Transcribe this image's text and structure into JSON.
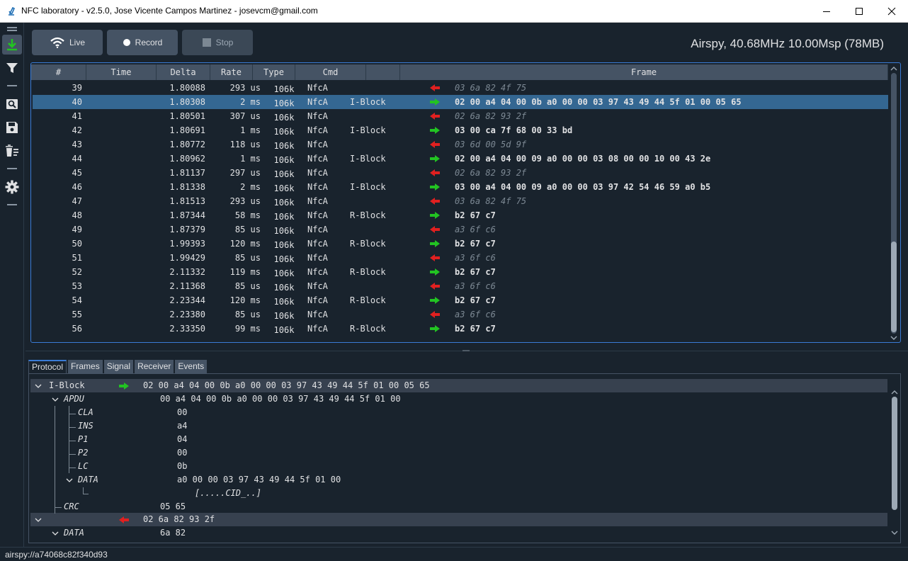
{
  "window": {
    "title": "NFC laboratory - v2.5.0, Jose Vicente Campos Martinez - josevcm@gmail.com"
  },
  "toolbar": {
    "live_label": "Live",
    "record_label": "Record",
    "stop_label": "Stop",
    "device_info": "Airspy, 40.68MHz 10.00Msp (78MB)"
  },
  "left_tools": [
    "download-icon",
    "filter-icon",
    "zoom-icon",
    "save-icon",
    "clear-icon",
    "gear-icon"
  ],
  "frames": {
    "columns": [
      "#",
      "Time",
      "Delta",
      "Rate",
      "Type",
      "Cmd",
      "",
      "Frame"
    ],
    "rows": [
      {
        "num": "39",
        "time": "1.80088",
        "delta": "293 us",
        "rate": "106k",
        "type": "NfcA",
        "cmd": "",
        "dir": "rx",
        "frame": "03 6a 82 4f 75"
      },
      {
        "num": "40",
        "time": "1.80308",
        "delta": "2 ms",
        "rate": "106k",
        "type": "NfcA",
        "cmd": "I-Block",
        "dir": "tx",
        "frame": "02 00 a4 04 00 0b a0 00 00 03 97 43 49 44 5f 01 00 05 65",
        "selected": true
      },
      {
        "num": "41",
        "time": "1.80501",
        "delta": "307 us",
        "rate": "106k",
        "type": "NfcA",
        "cmd": "",
        "dir": "rx",
        "frame": "02 6a 82 93 2f"
      },
      {
        "num": "42",
        "time": "1.80691",
        "delta": "1 ms",
        "rate": "106k",
        "type": "NfcA",
        "cmd": "I-Block",
        "dir": "tx",
        "frame": "03 00 ca 7f 68 00 33 bd"
      },
      {
        "num": "43",
        "time": "1.80772",
        "delta": "118 us",
        "rate": "106k",
        "type": "NfcA",
        "cmd": "",
        "dir": "rx",
        "frame": "03 6d 00 5d 9f"
      },
      {
        "num": "44",
        "time": "1.80962",
        "delta": "1 ms",
        "rate": "106k",
        "type": "NfcA",
        "cmd": "I-Block",
        "dir": "tx",
        "frame": "02 00 a4 04 00 09 a0 00 00 03 08 00 00 10 00 43 2e"
      },
      {
        "num": "45",
        "time": "1.81137",
        "delta": "297 us",
        "rate": "106k",
        "type": "NfcA",
        "cmd": "",
        "dir": "rx",
        "frame": "02 6a 82 93 2f"
      },
      {
        "num": "46",
        "time": "1.81338",
        "delta": "2 ms",
        "rate": "106k",
        "type": "NfcA",
        "cmd": "I-Block",
        "dir": "tx",
        "frame": "03 00 a4 04 00 09 a0 00 00 03 97 42 54 46 59 a0 b5"
      },
      {
        "num": "47",
        "time": "1.81513",
        "delta": "293 us",
        "rate": "106k",
        "type": "NfcA",
        "cmd": "",
        "dir": "rx",
        "frame": "03 6a 82 4f 75"
      },
      {
        "num": "48",
        "time": "1.87344",
        "delta": "58 ms",
        "rate": "106k",
        "type": "NfcA",
        "cmd": "R-Block",
        "dir": "tx",
        "frame": "b2 67 c7"
      },
      {
        "num": "49",
        "time": "1.87379",
        "delta": "85 us",
        "rate": "106k",
        "type": "NfcA",
        "cmd": "",
        "dir": "rx",
        "frame": "a3 6f c6"
      },
      {
        "num": "50",
        "time": "1.99393",
        "delta": "120 ms",
        "rate": "106k",
        "type": "NfcA",
        "cmd": "R-Block",
        "dir": "tx",
        "frame": "b2 67 c7"
      },
      {
        "num": "51",
        "time": "1.99429",
        "delta": "85 us",
        "rate": "106k",
        "type": "NfcA",
        "cmd": "",
        "dir": "rx",
        "frame": "a3 6f c6"
      },
      {
        "num": "52",
        "time": "2.11332",
        "delta": "119 ms",
        "rate": "106k",
        "type": "NfcA",
        "cmd": "R-Block",
        "dir": "tx",
        "frame": "b2 67 c7"
      },
      {
        "num": "53",
        "time": "2.11368",
        "delta": "85 us",
        "rate": "106k",
        "type": "NfcA",
        "cmd": "",
        "dir": "rx",
        "frame": "a3 6f c6"
      },
      {
        "num": "54",
        "time": "2.23344",
        "delta": "120 ms",
        "rate": "106k",
        "type": "NfcA",
        "cmd": "R-Block",
        "dir": "tx",
        "frame": "b2 67 c7"
      },
      {
        "num": "55",
        "time": "2.23380",
        "delta": "85 us",
        "rate": "106k",
        "type": "NfcA",
        "cmd": "",
        "dir": "rx",
        "frame": "a3 6f c6"
      },
      {
        "num": "56",
        "time": "2.33350",
        "delta": "99 ms",
        "rate": "106k",
        "type": "NfcA",
        "cmd": "R-Block",
        "dir": "tx",
        "frame": "b2 67 c7"
      }
    ]
  },
  "tabs": [
    {
      "label": "Protocol",
      "active": true
    },
    {
      "label": "Frames"
    },
    {
      "label": "Signal"
    },
    {
      "label": "Receiver"
    },
    {
      "label": "Events"
    }
  ],
  "protocol_tree": {
    "iblock_name": "I-Block",
    "iblock_value": "02 00 a4 04 00 0b a0 00 00 03 97 43 49 44 5f 01 00 05 65",
    "apdu_name": "APDU",
    "apdu_value": "00 a4 04 00 0b a0 00 00 03 97 43 49 44 5f 01 00",
    "cla_name": "CLA",
    "cla_value": "00",
    "ins_name": "INS",
    "ins_value": "a4",
    "p1_name": "P1",
    "p1_value": "04",
    "p2_name": "P2",
    "p2_value": "00",
    "lc_name": "LC",
    "lc_value": "0b",
    "data_name": "DATA",
    "data_value": "a0 00 00 03 97 43 49 44 5f 01 00",
    "data_ascii": "[.....CID_..]",
    "crc_name": "CRC",
    "crc_value": "05 65",
    "resp_value": "02 6a 82 93 2f",
    "resp_data_name": "DATA",
    "resp_data_value": "6a 82"
  },
  "status": {
    "text": "airspy://a74068c82f340d93"
  },
  "colors": {
    "background": "#19232d",
    "panel": "#455364",
    "selection": "#346792",
    "accent": "#3a7bd5",
    "tx_arrow": "#22c322",
    "rx_arrow": "#e02020"
  }
}
